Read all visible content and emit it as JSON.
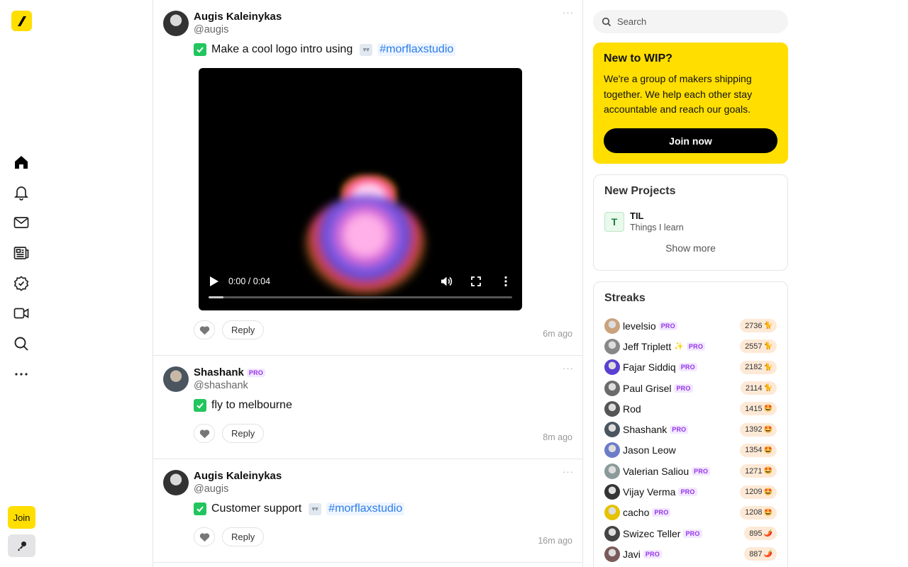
{
  "rail": {
    "nav": [
      "home-icon",
      "bell-icon",
      "mail-icon",
      "newspaper-icon",
      "badge-check-icon",
      "video-icon",
      "search-icon",
      "more-icon"
    ],
    "join_label": "Join"
  },
  "posts": [
    {
      "author": "Augis Kaleinykas",
      "handle": "@augis",
      "pro": false,
      "todo": "Make a cool logo intro using",
      "hashtag": "#morflaxstudio",
      "time": "6m ago",
      "video": {
        "time": "0:00 / 0:04",
        "progress": 0.05
      }
    },
    {
      "author": "Shashank",
      "handle": "@shashank",
      "pro": true,
      "todo": "fly to melbourne",
      "time": "8m ago"
    },
    {
      "author": "Augis Kaleinykas",
      "handle": "@augis",
      "pro": false,
      "todo": "Customer support",
      "hashtag": "#morflaxstudio",
      "time": "16m ago"
    }
  ],
  "reply_label": "Reply",
  "pro_label": "PRO",
  "search": {
    "placeholder": "Search"
  },
  "wip": {
    "title": "New to WIP?",
    "body": "We're a group of makers shipping together. We help each other stay accountable and reach our goals.",
    "cta": "Join now"
  },
  "new_projects": {
    "title": "New Projects",
    "items": [
      {
        "initial": "T",
        "name": "TIL",
        "desc": "Things I learn"
      }
    ],
    "show_more": "Show more"
  },
  "streaks": {
    "title": "Streaks",
    "items": [
      {
        "name": "levelsio",
        "pro": true,
        "count": "2736",
        "emoji": "🐈"
      },
      {
        "name": "Jeff Triplett",
        "sparkle": true,
        "pro": true,
        "count": "2557",
        "emoji": "🐈"
      },
      {
        "name": "Fajar Siddiq",
        "pro": true,
        "count": "2182",
        "emoji": "🐈"
      },
      {
        "name": "Paul Grisel",
        "pro": true,
        "count": "2114",
        "emoji": "🐈"
      },
      {
        "name": "Rod",
        "pro": false,
        "count": "1415",
        "emoji": "🤩"
      },
      {
        "name": "Shashank",
        "pro": true,
        "count": "1392",
        "emoji": "🤩"
      },
      {
        "name": "Jason Leow",
        "pro": false,
        "count": "1354",
        "emoji": "🤩"
      },
      {
        "name": "Valerian Saliou",
        "pro": true,
        "count": "1271",
        "emoji": "🤩"
      },
      {
        "name": "Vijay Verma",
        "pro": true,
        "count": "1209",
        "emoji": "🤩"
      },
      {
        "name": "cacho",
        "pro": true,
        "count": "1208",
        "emoji": "🤩"
      },
      {
        "name": "Swizec Teller",
        "pro": true,
        "count": "895",
        "emoji": "🌶️"
      },
      {
        "name": "Javi",
        "pro": true,
        "count": "887",
        "emoji": "🌶️"
      }
    ]
  },
  "colors": {
    "accent": "#ffde00",
    "check": "#22c55e",
    "hashtag": "#2b7de9",
    "pro": "#9333ea"
  }
}
